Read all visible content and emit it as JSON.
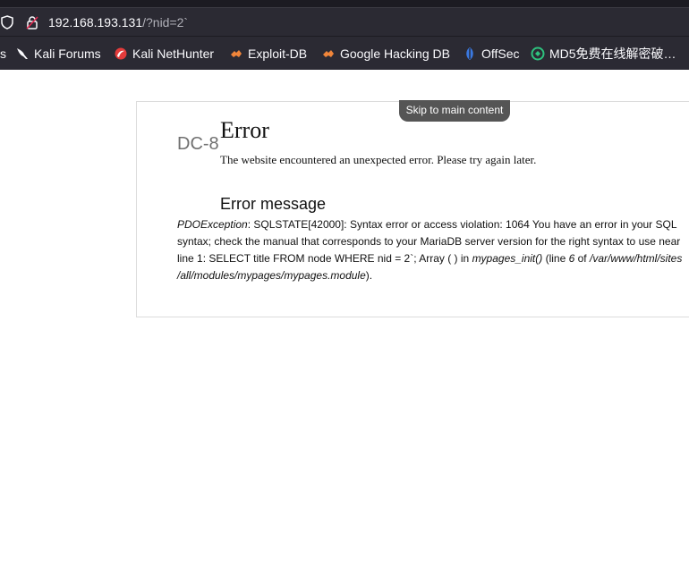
{
  "browser": {
    "url_host": "192.168.193.131",
    "url_path": "/?nid=2`",
    "bookmarks": [
      {
        "label": "s",
        "icon": "none"
      },
      {
        "label": "Kali Forums",
        "icon": "kali-dragon-icon"
      },
      {
        "label": "Kali NetHunter",
        "icon": "nethunter-icon"
      },
      {
        "label": "Exploit-DB",
        "icon": "exploit-db-icon"
      },
      {
        "label": "Google Hacking DB",
        "icon": "ghdb-icon"
      },
      {
        "label": "OffSec",
        "icon": "offsec-icon"
      },
      {
        "label": "MD5免费在线解密破…",
        "icon": "md5-icon"
      }
    ]
  },
  "page": {
    "skip_link": "Skip to main content",
    "site_name": "DC-8",
    "error_title": "Error",
    "error_description": "The website encountered an unexpected error. Please try again later.",
    "message_title": "Error message",
    "message": {
      "exception": "PDOException",
      "line1_text": ": SQLSTATE[42000]: Syntax error or access violation: 1064 You have an error in your SQL",
      "line2_text": "syntax; check the manual that corresponds to your MariaDB server version for the right syntax to use near",
      "line3_text": "line 1: SELECT title FROM node WHERE nid = 2`; Array ( ) in ",
      "function": "mypages_init()",
      "line_prefix": " (line ",
      "line_number": "6",
      "of_text": " of ",
      "path_part1": "/var/www/html/sites",
      "path_part2": "/all/modules/mypages/mypages.module",
      "closing": ")."
    }
  },
  "colors": {
    "chrome_dark": "#2b2a33",
    "tab_strip": "#1c1b22",
    "skip_bg": "#555555"
  }
}
